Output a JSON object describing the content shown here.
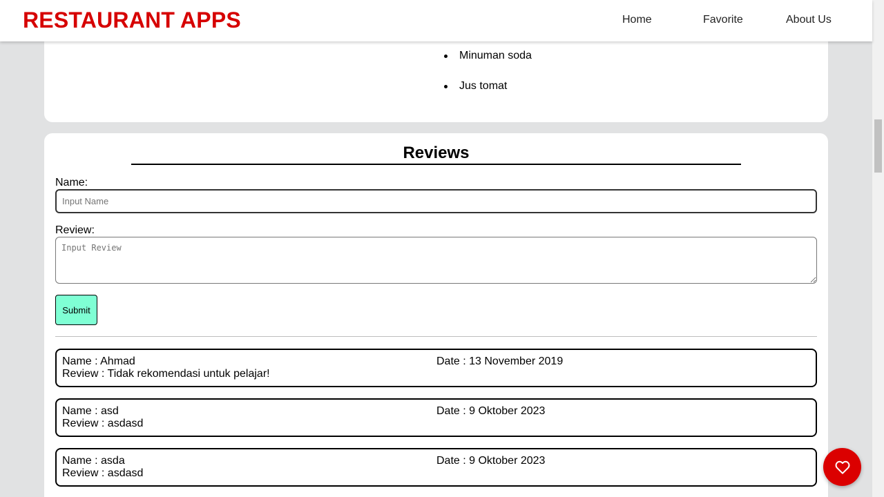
{
  "header": {
    "brand": "RESTAURANT APPS",
    "nav": [
      {
        "label": "Home"
      },
      {
        "label": "Favorite"
      },
      {
        "label": "About Us"
      }
    ]
  },
  "menu": {
    "drinks": [
      "Minuman soda",
      "Jus tomat"
    ]
  },
  "reviews": {
    "title": "Reviews",
    "form": {
      "name_label": "Name:",
      "name_placeholder": "Input Name",
      "review_label": "Review:",
      "review_placeholder": "Input Review",
      "submit_label": "Submit"
    },
    "items": [
      {
        "name": "Name : Ahmad",
        "date": "Date : 13 November 2019",
        "review": "Review : Tidak rekomendasi untuk pelajar!"
      },
      {
        "name": "Name : asd",
        "date": "Date : 9 Oktober 2023",
        "review": "Review : asdasd"
      },
      {
        "name": "Name : asda",
        "date": "Date : 9 Oktober 2023",
        "review": "Review : asdasd"
      }
    ]
  },
  "fab": {
    "icon": "heart-outline-icon"
  },
  "colors": {
    "brand": "#d60000",
    "submit_bg": "#7fffd4",
    "fab_bg": "#db0000",
    "page_bg": "#e1e2e3"
  }
}
